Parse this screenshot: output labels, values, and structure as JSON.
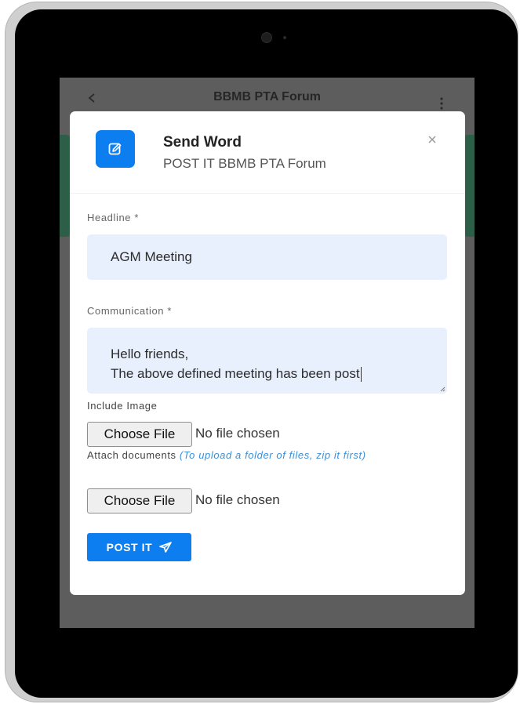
{
  "app_bar": {
    "title": "BBMB PTA Forum"
  },
  "modal": {
    "title": "Send Word",
    "subtitle": "POST IT BBMB PTA Forum",
    "headline": {
      "label": "Headline *",
      "value": "AGM Meeting"
    },
    "communication": {
      "label": "Communication *",
      "value_line1": "Hello friends,",
      "value_line2": "The above defined meeting has been post"
    },
    "include_image": {
      "label": "Include Image",
      "button": "Choose File",
      "status": "No file chosen"
    },
    "attach_documents": {
      "label": "Attach documents",
      "hint": "(To upload a folder of files, zip it first)",
      "button": "Choose File",
      "status": "No file chosen"
    },
    "submit_label": "POST IT"
  },
  "icons": {
    "header": "edit-icon",
    "close": "close-icon",
    "submit": "send-icon",
    "back": "back-icon",
    "more": "more-vertical-icon"
  },
  "colors": {
    "accent": "#0d7ef0",
    "input_background": "#e8f0fe",
    "hint": "#3a8fd9",
    "side_accent": "#2d5e47"
  }
}
